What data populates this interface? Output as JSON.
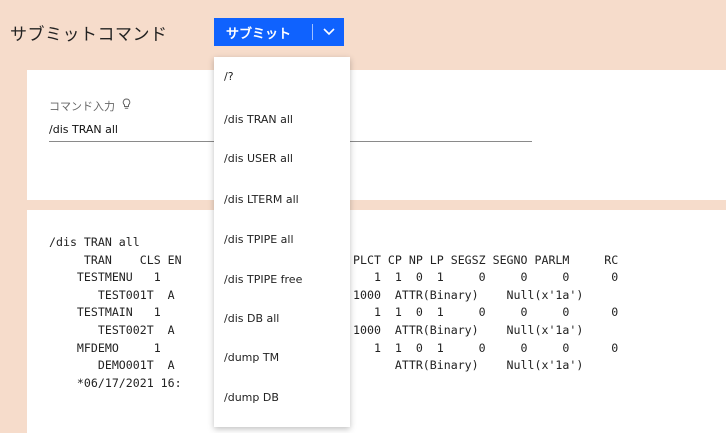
{
  "header": {
    "title": "サブミットコマンド"
  },
  "submit": {
    "label": "サブミット"
  },
  "input": {
    "label": "コマンド入力",
    "value": "/dis TRAN all"
  },
  "output": {
    "lines": [
      "/dis TRAN all",
      "     TRAN    CLS EN",
      "    TESTMENU   1",
      "       TEST001T  A",
      "    TESTMAIN   1",
      "       TEST002T  A",
      "    MFDEMO     1",
      "       DEMO001T  A",
      "    *06/17/2021 16:"
    ],
    "right_lines": [
      "",
      "PLCT CP NP LP SEGSZ SEGNO PARLM     RC",
      "   1  1  0  1     0     0     0      0",
      "1000  ATTR(Binary)    Null(x'1a')",
      "   1  1  0  1     0     0     0      0",
      "1000  ATTR(Binary)    Null(x'1a')",
      "   1  1  0  1     0     0     0      0",
      "      ATTR(Binary)    Null(x'1a')",
      ""
    ]
  },
  "menu": {
    "items": [
      "/?",
      "/dis TRAN all",
      "/dis USER all",
      "/dis LTERM all",
      "/dis TPIPE all",
      "/dis TPIPE free",
      "/dis DB all",
      "/dump TM",
      "/dump DB"
    ]
  }
}
